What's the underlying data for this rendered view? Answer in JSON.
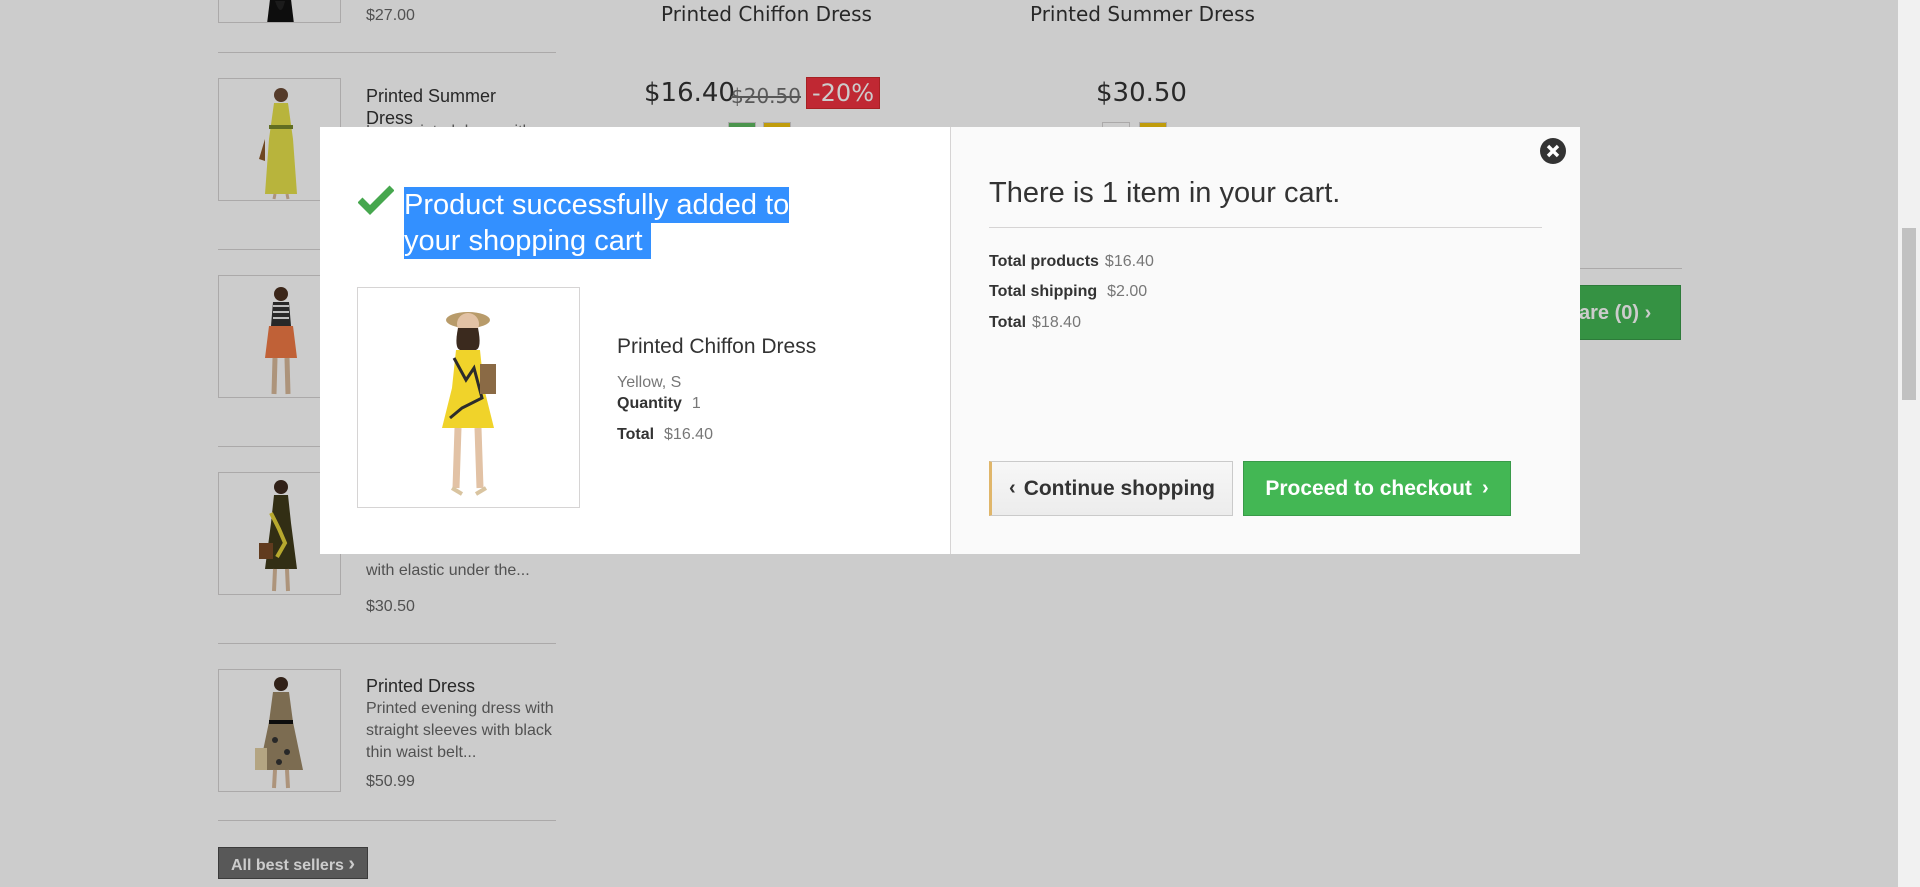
{
  "background": {
    "best_sellers": [
      {
        "price": "$27.00"
      },
      {
        "name": "Printed Summer Dress",
        "desc": "Long printed dress with",
        "price": ""
      },
      {
        "name": "",
        "desc": "",
        "price": ""
      },
      {
        "name": "",
        "desc": "with elastic under the...",
        "price": "$30.50"
      },
      {
        "name": "Printed Dress",
        "desc": "Printed evening dress with straight sleeves with black thin waist belt...",
        "price": "$50.99"
      }
    ],
    "all_best_sellers_label": "All best sellers",
    "products": [
      {
        "title": "Printed Chiffon Dress",
        "price": "$16.40",
        "old_price": "$20.50",
        "discount": "-20%"
      },
      {
        "title": "Printed Summer Dress",
        "price": "$30.50"
      }
    ],
    "compare_label": "are (0)",
    "colors": {
      "swatch_green": "#5eb961",
      "swatch_yellow": "#f1c40f",
      "swatch_white": "#ffffff"
    }
  },
  "modal": {
    "success_title": "Product successfully added to your shopping cart",
    "product": {
      "name": "Printed Chiffon Dress",
      "attributes": "Yellow, S",
      "quantity_label": "Quantity",
      "quantity_value": "1",
      "total_label": "Total",
      "total_value": "$16.40"
    },
    "cart": {
      "count_text": "There is 1 item in your cart.",
      "total_products_label": "Total products",
      "total_products_value": "$16.40",
      "total_shipping_label": "Total shipping",
      "total_shipping_value": "$2.00",
      "total_label": "Total",
      "total_value": "$18.40"
    },
    "continue_label": "Continue shopping",
    "checkout_label": "Proceed to checkout",
    "icons": {
      "close": "close-icon",
      "check": "check-icon"
    },
    "colors": {
      "accent_green": "#43b754",
      "selection_blue": "#3390ff"
    }
  }
}
